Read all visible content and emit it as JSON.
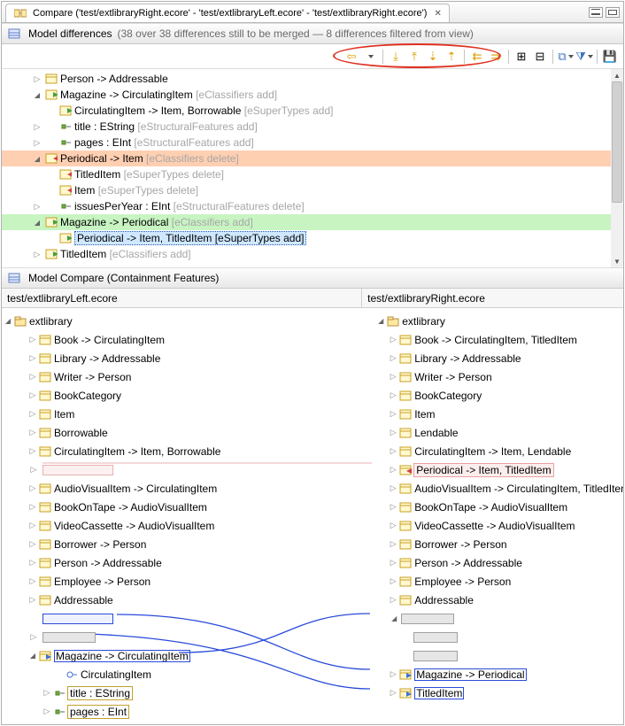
{
  "tabbar": {
    "tab_title": "Compare ('test/extlibraryRight.ecore' - 'test/extlibraryLeft.ecore' - 'test/extlibraryRight.ecore')",
    "close": "✕"
  },
  "differences_header": {
    "title": "Model differences",
    "detail": "(38 over 38 differences still to be merged — 8 differences filtered from view)"
  },
  "toolbar": {
    "back": "⇦",
    "next_diff": "↧",
    "prev_diff": "↥",
    "next_change": "↧",
    "prev_change": "↥",
    "copy_left": "⇇",
    "copy_right": "⇉",
    "expand": "⊞",
    "collapse": "⊟",
    "group": "⧉",
    "filter": "⧩",
    "save": "💾"
  },
  "diff_tree": {
    "r0": {
      "label": "Person -> Addressable"
    },
    "r1": {
      "label": "Magazine -> CirculatingItem",
      "ann": "[eClassifiers add]"
    },
    "r2": {
      "label": "CirculatingItem -> Item, Borrowable",
      "ann": "[eSuperTypes add]"
    },
    "r3": {
      "label": "title : EString",
      "ann": "[eStructuralFeatures add]"
    },
    "r4": {
      "label": "pages : EInt",
      "ann": "[eStructuralFeatures add]"
    },
    "r5": {
      "label": "Periodical -> Item",
      "ann": "[eClassifiers delete]"
    },
    "r6": {
      "label": "TitledItem",
      "ann": "[eSuperTypes delete]"
    },
    "r7": {
      "label": "Item",
      "ann": "[eSuperTypes delete]"
    },
    "r8": {
      "label": "issuesPerYear : EInt",
      "ann": "[eStructuralFeatures delete]"
    },
    "r9": {
      "label": "Magazine -> Periodical",
      "ann": "[eClassifiers add]"
    },
    "r10": {
      "label": "Periodical -> Item, TitledItem [eSuperTypes add]"
    },
    "r11": {
      "label": "TitledItem",
      "ann": "[eClassifiers add]"
    }
  },
  "compare_header": {
    "title": "Model Compare (Containment Features)"
  },
  "files": {
    "left": "test/extlibraryLeft.ecore",
    "right": "test/extlibraryRight.ecore"
  },
  "left_tree": {
    "root": "extlibrary",
    "items": [
      "Book -> CirculatingItem",
      "Library -> Addressable",
      "Writer -> Person",
      "BookCategory",
      "Item",
      "Borrowable",
      "CirculatingItem -> Item, Borrowable"
    ],
    "items2": [
      "AudioVisualItem -> CirculatingItem",
      "BookOnTape -> AudioVisualItem",
      "VideoCassette -> AudioVisualItem",
      "Borrower -> Person",
      "Person -> Addressable",
      "Employee -> Person",
      "Addressable"
    ],
    "mag": "Magazine -> CirculatingItem",
    "mag_children": {
      "c0": "CirculatingItem",
      "c1": "title : EString",
      "c2": "pages : EInt"
    }
  },
  "right_tree": {
    "root": "extlibrary",
    "items": [
      "Book -> CirculatingItem, TitledItem",
      "Library -> Addressable",
      "Writer -> Person",
      "BookCategory",
      "Item",
      "Lendable",
      "CirculatingItem -> Item, Lendable"
    ],
    "periodical": "Periodical -> Item, TitledItem",
    "items2": [
      "AudioVisualItem -> CirculatingItem, TitledItem",
      "BookOnTape -> AudioVisualItem",
      "VideoCassette -> AudioVisualItem",
      "Borrower -> Person",
      "Person -> Addressable",
      "Employee -> Person",
      "Addressable"
    ],
    "magazine": "Magazine -> Periodical",
    "titled": "TitledItem"
  }
}
